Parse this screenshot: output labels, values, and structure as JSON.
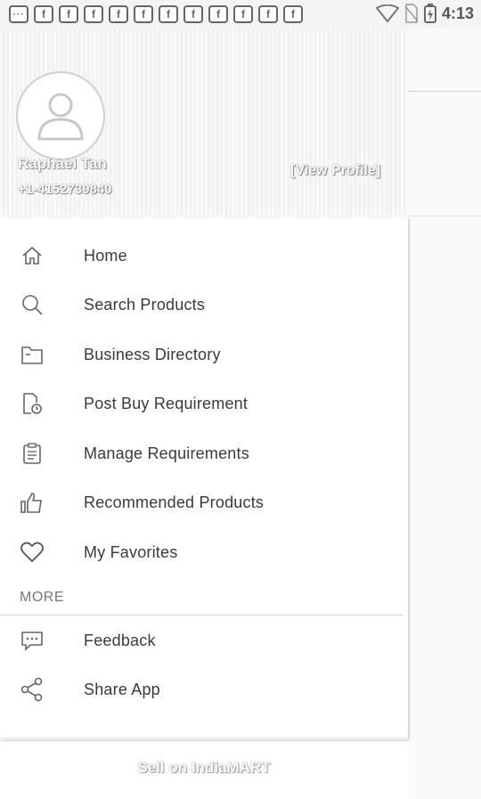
{
  "statusbar": {
    "time": "4:13",
    "notification_icons": [
      "message-icon",
      "facebook-icon",
      "facebook-icon",
      "facebook-icon",
      "facebook-icon",
      "facebook-icon",
      "facebook-icon",
      "facebook-icon",
      "facebook-icon",
      "facebook-icon",
      "facebook-icon",
      "facebook-icon"
    ]
  },
  "profile": {
    "name": "Raphael Tan",
    "phone": "+1-4152739840",
    "view_profile": "[View Profile]"
  },
  "menu": {
    "items": [
      {
        "label": "Home",
        "icon": "home-icon"
      },
      {
        "label": "Search Products",
        "icon": "search-icon"
      },
      {
        "label": "Business Directory",
        "icon": "folder-icon"
      },
      {
        "label": "Post Buy Requirement",
        "icon": "document-clock-icon"
      },
      {
        "label": "Manage Requirements",
        "icon": "clipboard-icon"
      },
      {
        "label": "Recommended Products",
        "icon": "thumbs-up-icon"
      },
      {
        "label": "My Favorites",
        "icon": "heart-icon"
      }
    ],
    "section_more": "MORE",
    "more_items": [
      {
        "label": "Feedback",
        "icon": "chat-icon"
      },
      {
        "label": "Share App",
        "icon": "share-icon"
      }
    ]
  },
  "footer": {
    "sell_label": "Sell on IndiaMART"
  }
}
